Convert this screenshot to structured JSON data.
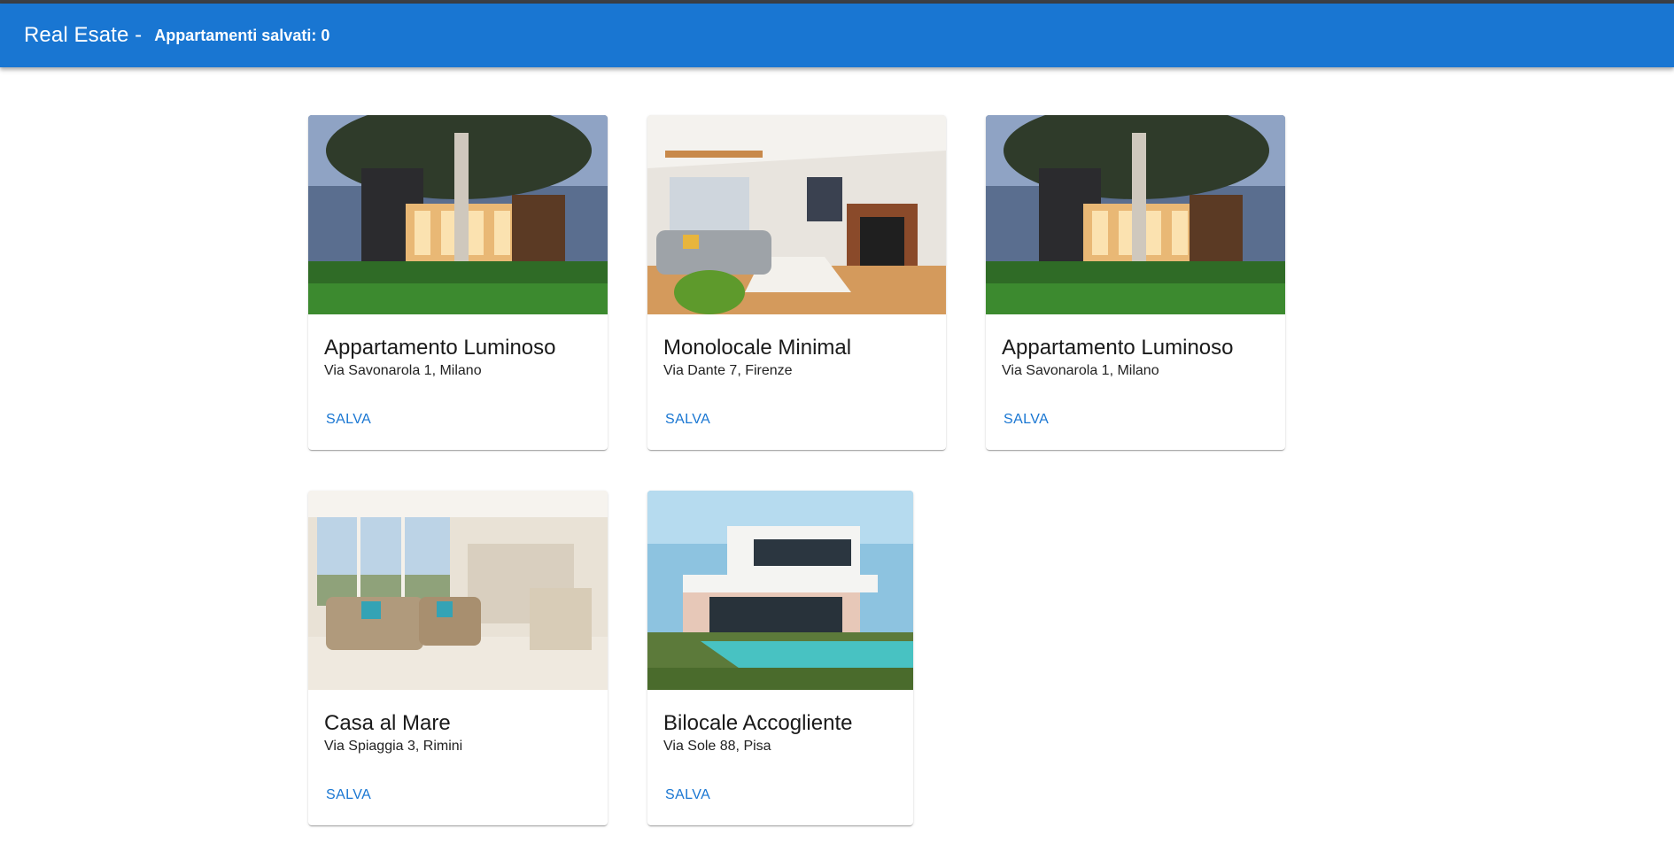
{
  "appbar": {
    "brand": "Real Esate -",
    "saved_label": "Appartamenti salvati: 0"
  },
  "colors": {
    "primary": "#1976d2",
    "topstrip": "#3b3f45",
    "background": "#ffffff"
  },
  "listings": [
    {
      "title": "Appartamento Luminoso",
      "address": "Via Savonarola 1, Milano",
      "action": "SALVA",
      "image": "modern-house-night"
    },
    {
      "title": "Monolocale Minimal",
      "address": "Via Dante 7, Firenze",
      "action": "SALVA",
      "image": "living-room-fireplace"
    },
    {
      "title": "Appartamento Luminoso",
      "address": "Via Savonarola 1, Milano",
      "action": "SALVA",
      "image": "modern-house-night"
    },
    {
      "title": "Casa al Mare",
      "address": "Via Spiaggia 3, Rimini",
      "action": "SALVA",
      "image": "bright-living-room"
    },
    {
      "title": "Bilocale Accogliente",
      "address": "Via Sole 88, Pisa",
      "action": "SALVA",
      "image": "villa-with-pool"
    }
  ]
}
